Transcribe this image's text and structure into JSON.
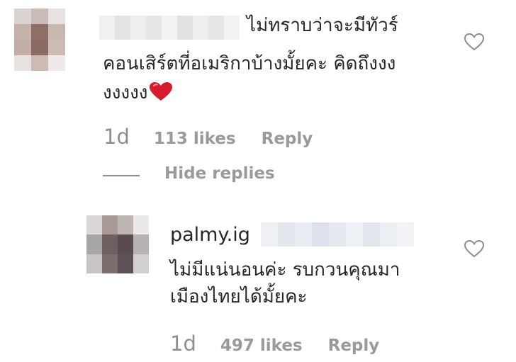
{
  "comment": {
    "text_line1": "ไม่ทราบว่าจะมีทัวร์",
    "text_line2": "คอนเสิร์ตที่อเมริกาบ้างมั้ยคะ คิดถึงงง",
    "text_line3": "งงงงง",
    "time": "1d",
    "likes": "113 likes",
    "reply_label": "Reply",
    "like_icon": "heart-outline",
    "emoji": "red-heart"
  },
  "replies_toggle": {
    "label": "Hide replies"
  },
  "reply": {
    "username": "palmy.ig",
    "text_line1": "ไม่มีแน่นอนค่ะ รบกวนคุณมา",
    "text_line2": "เมืองไทยได้มั้ยคะ",
    "time": "1d",
    "likes": "497 likes",
    "reply_label": "Reply",
    "like_icon": "heart-outline"
  },
  "colors": {
    "text": "#262626",
    "secondary": "#8e8e8e",
    "heart_emoji": "#d81b2b"
  }
}
